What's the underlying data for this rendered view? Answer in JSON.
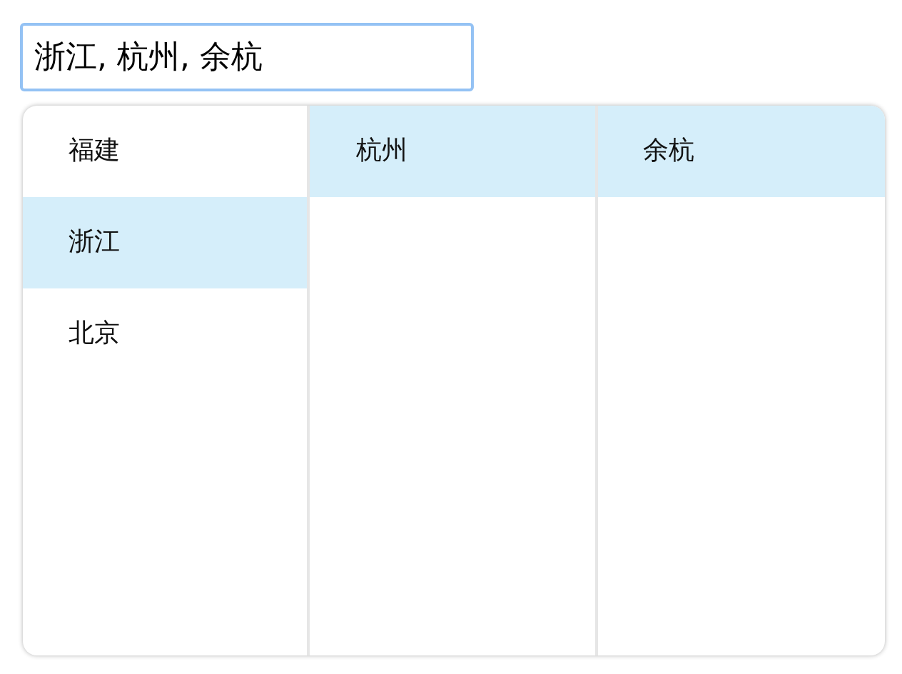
{
  "input": {
    "value": "浙江, 杭州, 余杭",
    "focused": true
  },
  "columns": [
    {
      "items": [
        {
          "label": "福建",
          "selected": false
        },
        {
          "label": "浙江",
          "selected": true
        },
        {
          "label": "北京",
          "selected": false
        }
      ]
    },
    {
      "items": [
        {
          "label": "杭州",
          "selected": true
        }
      ]
    },
    {
      "items": [
        {
          "label": "余杭",
          "selected": true
        }
      ]
    }
  ]
}
